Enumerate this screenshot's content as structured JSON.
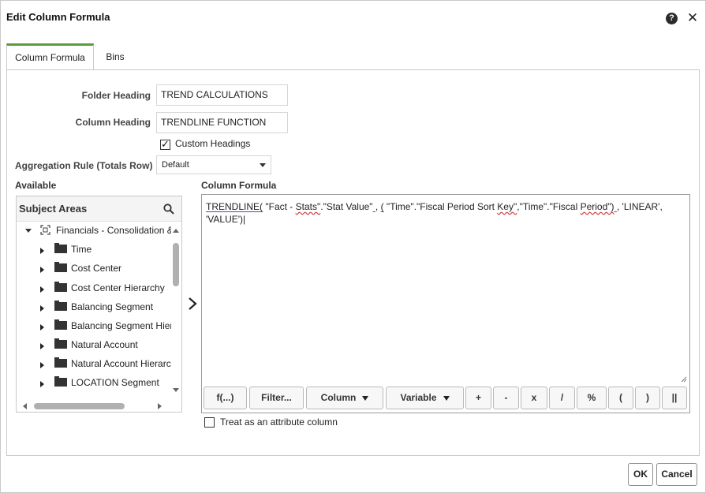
{
  "dialog": {
    "title": "Edit Column Formula",
    "help_icon": "question-circle-icon",
    "close_icon": "close-icon",
    "close_glyph": "✕"
  },
  "tabs": [
    {
      "label": "Column Formula",
      "active": true
    },
    {
      "label": "Bins",
      "active": false
    }
  ],
  "form": {
    "folder_heading_label": "Folder Heading",
    "folder_heading_value": "TREND CALCULATIONS",
    "column_heading_label": "Column Heading",
    "column_heading_value": "TRENDLINE FUNCTION",
    "custom_headings_label": "Custom Headings",
    "custom_headings_checked": true,
    "aggregation_label": "Aggregation Rule (Totals Row)",
    "aggregation_value": "Default"
  },
  "available": {
    "section_label": "Available",
    "header": "Subject Areas",
    "tree": [
      {
        "label": "Financials - Consolidation &",
        "level": 0,
        "expanded": true,
        "icon": "subject-area-icon"
      },
      {
        "label": "Time",
        "level": 1,
        "icon": "folder-icon"
      },
      {
        "label": "Cost Center",
        "level": 1,
        "icon": "folder-icon"
      },
      {
        "label": "Cost Center Hierarchy",
        "level": 1,
        "icon": "folder-icon"
      },
      {
        "label": "Balancing Segment",
        "level": 1,
        "icon": "folder-icon"
      },
      {
        "label": "Balancing Segment Hier",
        "level": 1,
        "icon": "folder-icon"
      },
      {
        "label": "Natural Account",
        "level": 1,
        "icon": "folder-icon"
      },
      {
        "label": "Natural Account Hierarc",
        "level": 1,
        "icon": "folder-icon"
      },
      {
        "label": "LOCATION Segment",
        "level": 1,
        "icon": "folder-icon"
      }
    ]
  },
  "formula": {
    "section_label": "Column Formula",
    "parts": [
      {
        "text": "TRENDLINE(",
        "style": "uline"
      },
      {
        "text": " \"Fact - ",
        "style": ""
      },
      {
        "text": "Stats\"",
        "style": "squig"
      },
      {
        "text": ".\"Stat Value\"",
        "style": ""
      },
      {
        "text": "  ",
        "style": "uline"
      },
      {
        "text": ",   ",
        "style": ""
      },
      {
        "text": "(",
        "style": "uline"
      },
      {
        "text": " \"Time\".\"Fiscal Period Sort ",
        "style": ""
      },
      {
        "text": "Key\"",
        "style": "squig"
      },
      {
        "text": ",\"Time\".\"Fiscal ",
        "style": ""
      },
      {
        "text": "Period\")",
        "style": "squig"
      },
      {
        "text": "  ",
        "style": "uline"
      },
      {
        "text": ", 'LINEAR', 'VALUE')|",
        "style": ""
      }
    ],
    "toolbar": [
      {
        "label": "f(...)",
        "dropdown": false
      },
      {
        "label": "Filter...",
        "dropdown": false
      },
      {
        "label": "Column",
        "dropdown": true
      },
      {
        "label": "Variable",
        "dropdown": true
      },
      {
        "label": "+",
        "dropdown": false
      },
      {
        "label": "-",
        "dropdown": false
      },
      {
        "label": "x",
        "dropdown": false
      },
      {
        "label": "/",
        "dropdown": false
      },
      {
        "label": "%",
        "dropdown": false
      },
      {
        "label": "(",
        "dropdown": false
      },
      {
        "label": ")",
        "dropdown": false
      },
      {
        "label": "||",
        "dropdown": false
      }
    ],
    "treat_as_attribute_label": "Treat as an attribute column",
    "treat_as_attribute_checked": false
  },
  "footer": {
    "ok_label": "OK",
    "cancel_label": "Cancel"
  },
  "colors": {
    "active_tab_accent": "#5b9a3a",
    "spellcheck_underline": "#d43f3f",
    "syntax_underline": "#2a5fb0"
  }
}
